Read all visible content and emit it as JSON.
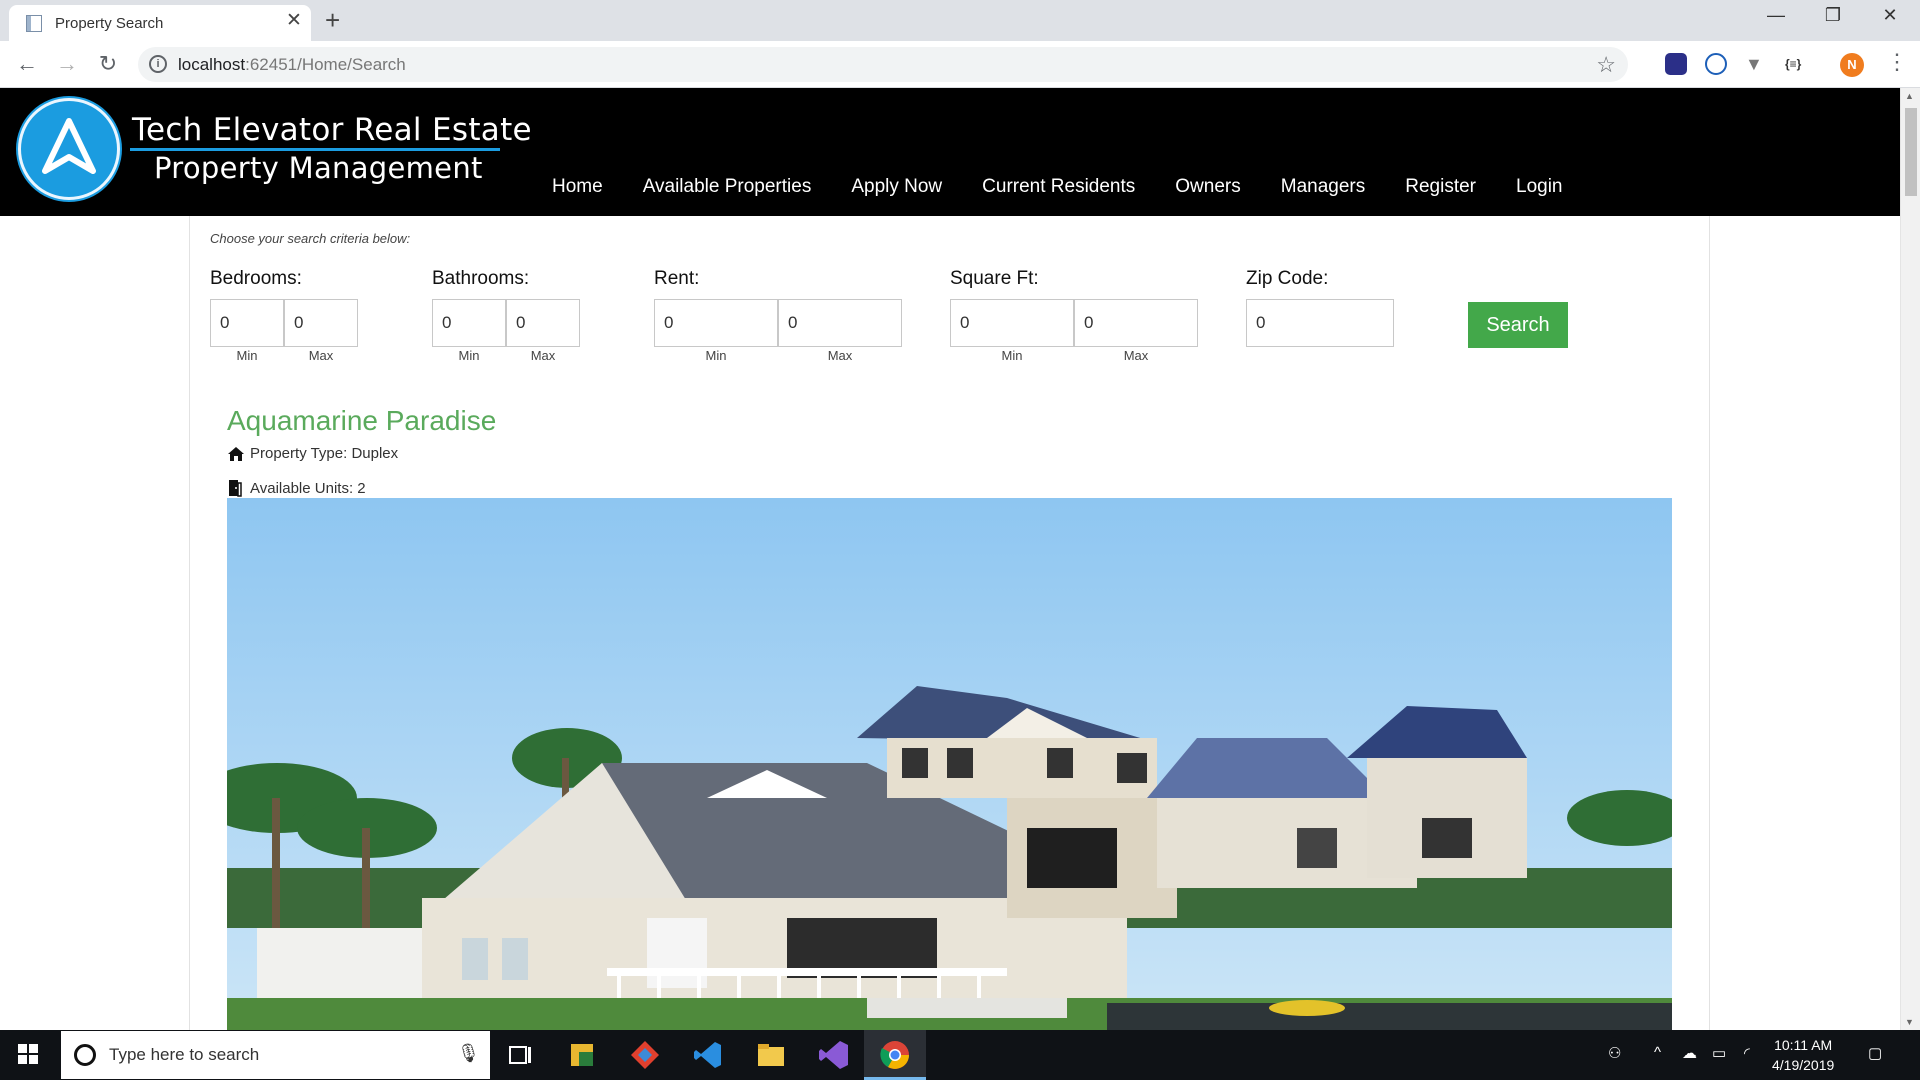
{
  "browser": {
    "tab_title": "Property Search",
    "url_host": "localhost",
    "url_rest": ":62451/Home/Search",
    "profile_initial": "N"
  },
  "site": {
    "brand_line1": "Tech Elevator Real Estate",
    "brand_line2": "Property Management",
    "nav": [
      "Home",
      "Available Properties",
      "Apply Now",
      "Current Residents",
      "Owners",
      "Managers",
      "Register",
      "Login"
    ]
  },
  "search": {
    "note": "Choose your search criteria below:",
    "bedrooms": {
      "label": "Bedrooms:",
      "min": "0",
      "max": "0",
      "min_label": "Min",
      "max_label": "Max"
    },
    "bathrooms": {
      "label": "Bathrooms:",
      "min": "0",
      "max": "0",
      "min_label": "Min",
      "max_label": "Max"
    },
    "rent": {
      "label": "Rent:",
      "min": "0",
      "max": "0",
      "min_label": "Min",
      "max_label": "Max"
    },
    "sqft": {
      "label": "Square Ft:",
      "min": "0",
      "max": "0",
      "min_label": "Min",
      "max_label": "Max"
    },
    "zip": {
      "label": "Zip Code:",
      "value": "0"
    },
    "button": "Search"
  },
  "property": {
    "title": "Aquamarine Paradise",
    "type_text": "Property Type: Duplex",
    "units_text": "Available Units: 2"
  },
  "taskbar": {
    "search_placeholder": "Type here to search",
    "time": "10:11 AM",
    "date": "4/19/2019"
  },
  "colors": {
    "header_bg": "#000000",
    "accent_blue": "#1b9ce0",
    "title_green": "#5aaa5c",
    "button_green": "#43a84a"
  }
}
